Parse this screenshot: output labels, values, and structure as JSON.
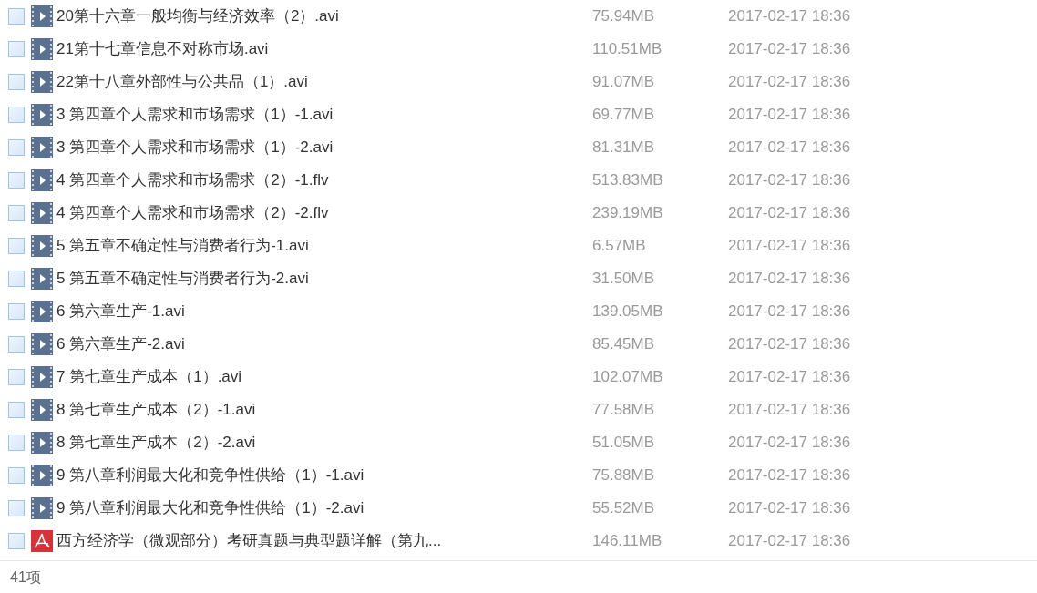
{
  "files": [
    {
      "kind": "video",
      "checked": false,
      "name": "20第十六章一般均衡与经济效率（2）.avi",
      "size": "75.94MB",
      "modified": "2017-02-17 18:36"
    },
    {
      "kind": "video",
      "checked": false,
      "name": "21第十七章信息不对称市场.avi",
      "size": "110.51MB",
      "modified": "2017-02-17 18:36"
    },
    {
      "kind": "video",
      "checked": false,
      "name": "22第十八章外部性与公共品（1）.avi",
      "size": "91.07MB",
      "modified": "2017-02-17 18:36"
    },
    {
      "kind": "video",
      "checked": false,
      "name": "3 第四章个人需求和市场需求（1）-1.avi",
      "size": "69.77MB",
      "modified": "2017-02-17 18:36"
    },
    {
      "kind": "video",
      "checked": false,
      "name": "3 第四章个人需求和市场需求（1）-2.avi",
      "size": "81.31MB",
      "modified": "2017-02-17 18:36"
    },
    {
      "kind": "video",
      "checked": false,
      "name": "4 第四章个人需求和市场需求（2）-1.flv",
      "size": "513.83MB",
      "modified": "2017-02-17 18:36"
    },
    {
      "kind": "video",
      "checked": false,
      "name": "4 第四章个人需求和市场需求（2）-2.flv",
      "size": "239.19MB",
      "modified": "2017-02-17 18:36"
    },
    {
      "kind": "video",
      "checked": false,
      "name": "5 第五章不确定性与消费者行为-1.avi",
      "size": "6.57MB",
      "modified": "2017-02-17 18:36"
    },
    {
      "kind": "video",
      "checked": false,
      "name": "5 第五章不确定性与消费者行为-2.avi",
      "size": "31.50MB",
      "modified": "2017-02-17 18:36"
    },
    {
      "kind": "video",
      "checked": false,
      "name": "6 第六章生产-1.avi",
      "size": "139.05MB",
      "modified": "2017-02-17 18:36"
    },
    {
      "kind": "video",
      "checked": false,
      "name": "6 第六章生产-2.avi",
      "size": "85.45MB",
      "modified": "2017-02-17 18:36"
    },
    {
      "kind": "video",
      "checked": false,
      "name": "7 第七章生产成本（1）.avi",
      "size": "102.07MB",
      "modified": "2017-02-17 18:36"
    },
    {
      "kind": "video",
      "checked": false,
      "name": "8 第七章生产成本（2）-1.avi",
      "size": "77.58MB",
      "modified": "2017-02-17 18:36"
    },
    {
      "kind": "video",
      "checked": false,
      "name": "8 第七章生产成本（2）-2.avi",
      "size": "51.05MB",
      "modified": "2017-02-17 18:36"
    },
    {
      "kind": "video",
      "checked": false,
      "name": "9 第八章利润最大化和竞争性供给（1）-1.avi",
      "size": "75.88MB",
      "modified": "2017-02-17 18:36"
    },
    {
      "kind": "video",
      "checked": false,
      "name": "9 第八章利润最大化和竞争性供给（1）-2.avi",
      "size": "55.52MB",
      "modified": "2017-02-17 18:36"
    },
    {
      "kind": "pdf",
      "checked": false,
      "name": "西方经济学（微观部分）考研真题与典型题详解（第九...",
      "size": "146.11MB",
      "modified": "2017-02-17 18:36"
    }
  ],
  "status_bar": {
    "count": "41项"
  }
}
